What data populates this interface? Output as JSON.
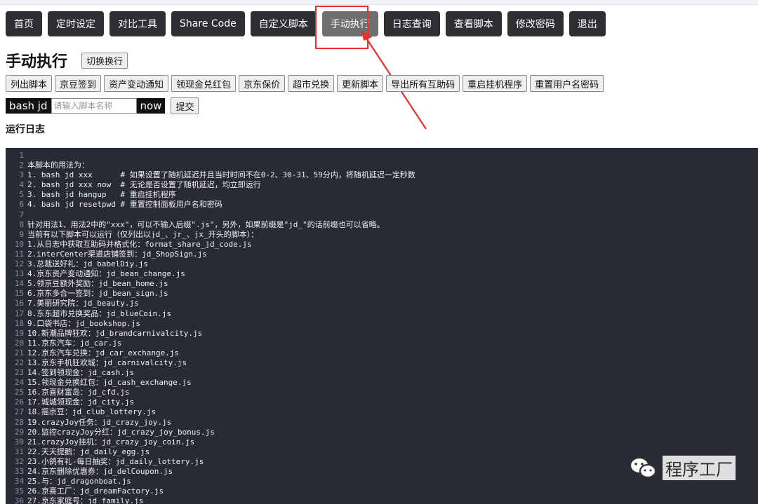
{
  "nav": {
    "items": [
      {
        "label": "首页",
        "active": false
      },
      {
        "label": "定时设定",
        "active": false
      },
      {
        "label": "对比工具",
        "active": false
      },
      {
        "label": "Share Code",
        "active": false
      },
      {
        "label": "自定义脚本",
        "active": false
      },
      {
        "label": "手动执行",
        "active": true
      },
      {
        "label": "日志查询",
        "active": false
      },
      {
        "label": "查看脚本",
        "active": false
      },
      {
        "label": "修改密码",
        "active": false
      },
      {
        "label": "退出",
        "active": false
      }
    ]
  },
  "header": {
    "title": "手动执行",
    "switch_label": "切换换行"
  },
  "actions": [
    "列出脚本",
    "京豆签到",
    "资产变动通知",
    "领现金兑红包",
    "京东保价",
    "超市兑换",
    "更新脚本",
    "导出所有互助码",
    "重启挂机程序",
    "重置用户名密码"
  ],
  "command": {
    "prefix": "bash jd",
    "placeholder": "请输入脚本名称",
    "suffix": "now",
    "submit_label": "提交"
  },
  "log": {
    "heading": "运行日志",
    "lines": [
      "",
      "本脚本的用法为：",
      "1. bash jd xxx      # 如果设置了随机延迟并且当时时间不在0-2、30-31、59分内，将随机延迟一定秒数",
      "2. bash jd xxx now  # 无论是否设置了随机延迟，均立即运行",
      "3. bash jd hangup   # 重启挂机程序",
      "4. bash jd resetpwd # 重置控制面板用户名和密码",
      "",
      "针对用法1、用法2中的\"xxx\"，可以不输入后缀\".js\"，另外，如果前缀是\"jd_\"的话前缀也可以省略。",
      "当前有以下脚本可以运行（仅列出以jd_、jr_、jx_开头的脚本）：",
      "1.从日志中获取互助码并格式化：format_share_jd_code.js",
      "2.interCenter渠道店铺签到：jd_ShopSign.js",
      "3.总裁送好礼：jd_babelDiy.js",
      "4.京东资产变动通知：jd_bean_change.js",
      "5.领京豆额外奖励：jd_bean_home.js",
      "6.京东多合一签到：jd_bean_sign.js",
      "7.美丽研究院：jd_beauty.js",
      "8.东东超市兑换奖品：jd_blueCoin.js",
      "9.口袋书店：jd_bookshop.js",
      "10.新潮品牌狂欢：jd_brandcarnivalcity.js",
      "11.京东汽车：jd_car.js",
      "12.京东汽车兑换：jd_car_exchange.js",
      "13.京东手机狂欢城：jd_carnivalcity.js",
      "14.签到领现金：jd_cash.js",
      "15.领现金兑换红包：jd_cash_exchange.js",
      "16.京喜财富岛：jd_cfd.js",
      "17.城城领现金：jd_city.js",
      "18.摇京豆：jd_club_lottery.js",
      "19.crazyJoy任务：jd_crazy_joy.js",
      "20.监控crazyJoy分红：jd_crazy_joy_bonus.js",
      "21.crazyJoy挂机：jd_crazy_joy_coin.js",
      "22.天天提鹅：jd_daily_egg.js",
      "23.小鸽有礼-每日抽奖：jd_daily_lottery.js",
      "24.京东删除优惠券：jd_delCoupon.js",
      "25.与：jd_dragonboat.js",
      "26.京喜工厂：jd_dreamFactory.js",
      "27.京东家庭号：jd_family.js"
    ]
  },
  "watermark": {
    "text": "程序工厂",
    "icon": "wechat-icon"
  },
  "colors": {
    "nav_bg": "#2d2f33",
    "nav_active_bg": "#6f6f6f",
    "log_bg": "#282a36",
    "highlight": "#e8332a"
  }
}
